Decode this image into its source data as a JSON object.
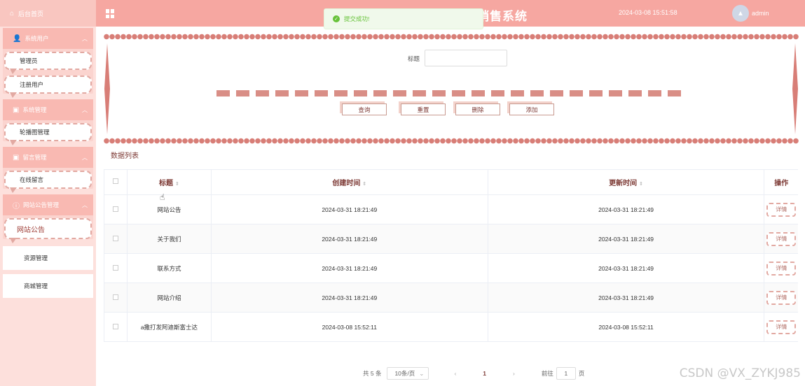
{
  "sidebar": {
    "home": "后台首页",
    "groups": [
      {
        "title": "系统用户",
        "items": [
          "管理员",
          "注册用户"
        ]
      },
      {
        "title": "系统管理",
        "items": [
          "轮播图管理"
        ]
      },
      {
        "title": "留言管理",
        "items": [
          "在线留言"
        ]
      },
      {
        "title": "网站公告管理",
        "items": [
          "网站公告"
        ]
      }
    ],
    "plain_items": [
      "资源管理",
      "商城管理"
    ]
  },
  "header": {
    "title": "助农农产品小程序销售系统",
    "datetime": "2024-03-08 15:51:58",
    "user": "admin"
  },
  "toast": {
    "message": "提交成功!"
  },
  "search": {
    "label": "标题",
    "value": "",
    "buttons": [
      "查询",
      "重置",
      "删除",
      "添加"
    ]
  },
  "list_title": "数据列表",
  "table": {
    "headers": [
      "标题",
      "创建时间",
      "更新时间",
      "操作"
    ],
    "rows": [
      {
        "title": "网站公告",
        "created": "2024-03-31 18:21:49",
        "updated": "2024-03-31 18:21:49",
        "action": "详情"
      },
      {
        "title": "关于我们",
        "created": "2024-03-31 18:21:49",
        "updated": "2024-03-31 18:21:49",
        "action": "详情"
      },
      {
        "title": "联系方式",
        "created": "2024-03-31 18:21:49",
        "updated": "2024-03-31 18:21:49",
        "action": "详情"
      },
      {
        "title": "网站介绍",
        "created": "2024-03-31 18:21:49",
        "updated": "2024-03-31 18:21:49",
        "action": "详情"
      },
      {
        "title": "a撒打发阿迪斯富士达",
        "created": "2024-03-08 15:52:11",
        "updated": "2024-03-08 15:52:11",
        "action": "详情"
      }
    ]
  },
  "pagination": {
    "total": "共 5 条",
    "page_size": "10条/页",
    "current": "1",
    "goto_label": "前往",
    "goto_value": "1",
    "page_suffix": "页"
  },
  "watermark": "CSDN @VX_ZYKJ985",
  "colors": {
    "accent": "#f6a7a1",
    "sidebar_bg": "#fde0dc",
    "text_accent": "#7d3a35",
    "success": "#67c23a"
  }
}
